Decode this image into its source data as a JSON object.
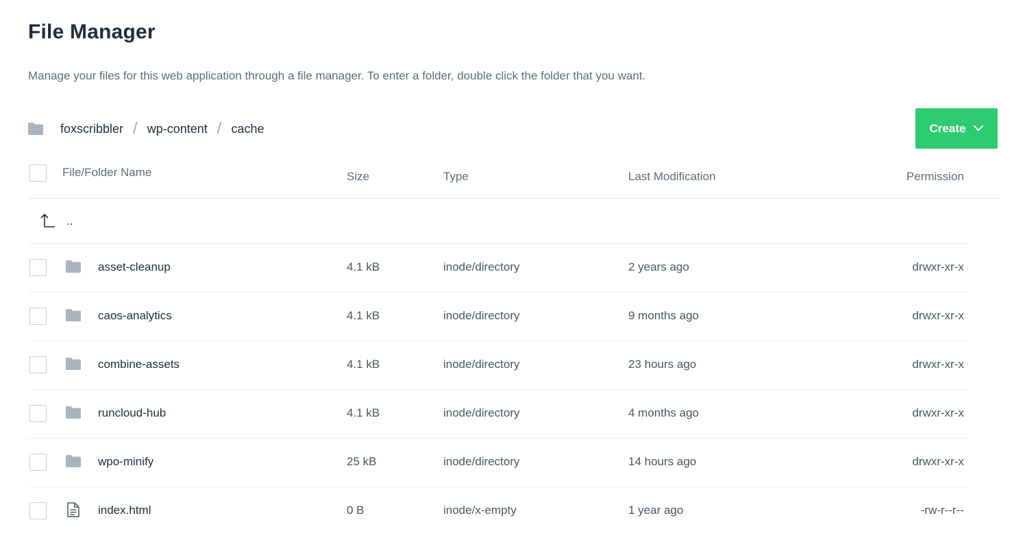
{
  "header": {
    "title": "File Manager",
    "description": "Manage your files for this web application through a file manager. To enter a folder, double click the folder that you want."
  },
  "breadcrumb": {
    "icon": "folder-icon",
    "items": [
      "foxscribbler",
      "wp-content",
      "cache"
    ],
    "separator": "/"
  },
  "toolbar": {
    "create_label": "Create",
    "create_color": "#2ecc71"
  },
  "table": {
    "columns": {
      "name": "File/Folder Name",
      "size": "Size",
      "type": "Type",
      "modified": "Last Modification",
      "permission": "Permission"
    },
    "parent_label": "..",
    "rows": [
      {
        "icon": "folder-icon",
        "name": "asset-cleanup",
        "size": "4.1 kB",
        "type": "inode/directory",
        "modified": "2 years ago",
        "permission": "drwxr-xr-x"
      },
      {
        "icon": "folder-icon",
        "name": "caos-analytics",
        "size": "4.1 kB",
        "type": "inode/directory",
        "modified": "9 months ago",
        "permission": "drwxr-xr-x"
      },
      {
        "icon": "folder-icon",
        "name": "combine-assets",
        "size": "4.1 kB",
        "type": "inode/directory",
        "modified": "23 hours ago",
        "permission": "drwxr-xr-x"
      },
      {
        "icon": "folder-icon",
        "name": "runcloud-hub",
        "size": "4.1 kB",
        "type": "inode/directory",
        "modified": "4 months ago",
        "permission": "drwxr-xr-x"
      },
      {
        "icon": "folder-icon",
        "name": "wpo-minify",
        "size": "25 kB",
        "type": "inode/directory",
        "modified": "14 hours ago",
        "permission": "drwxr-xr-x"
      },
      {
        "icon": "file-icon",
        "name": "index.html",
        "size": "0 B",
        "type": "inode/x-empty",
        "modified": "1 year ago",
        "permission": "-rw-r--r--"
      }
    ]
  },
  "colors": {
    "folder_icon": "#a9b4bf",
    "accent": "#2ecc71"
  }
}
